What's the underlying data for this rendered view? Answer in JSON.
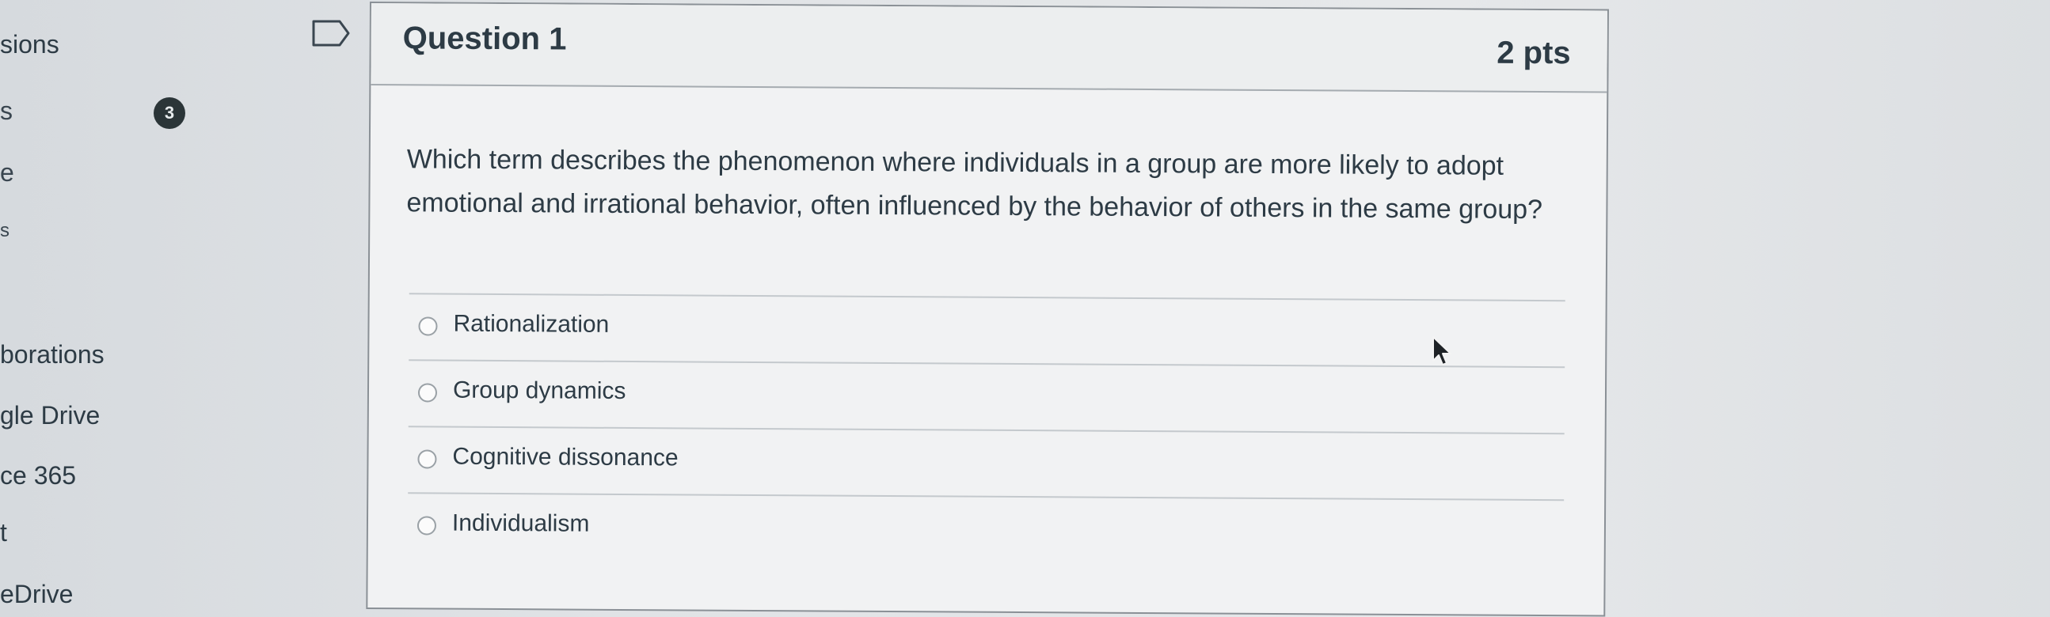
{
  "sidebar": {
    "items": [
      {
        "label": "sions"
      },
      {
        "label": "s"
      },
      {
        "label": "e"
      },
      {
        "label": "s"
      },
      {
        "label": "borations"
      },
      {
        "label": "gle Drive"
      },
      {
        "label": "ce 365"
      },
      {
        "label": "t"
      },
      {
        "label": "eDrive"
      }
    ],
    "badge_count": "3"
  },
  "question": {
    "title": "Question 1",
    "points": "2 pts",
    "text": "Which term describes the phenomenon where individuals in a group are more likely to adopt emotional and irrational behavior, often influenced by the behavior of others in the same group?",
    "answers": [
      {
        "label": "Rationalization"
      },
      {
        "label": "Group dynamics"
      },
      {
        "label": "Cognitive dissonance"
      },
      {
        "label": "Individualism"
      }
    ]
  }
}
